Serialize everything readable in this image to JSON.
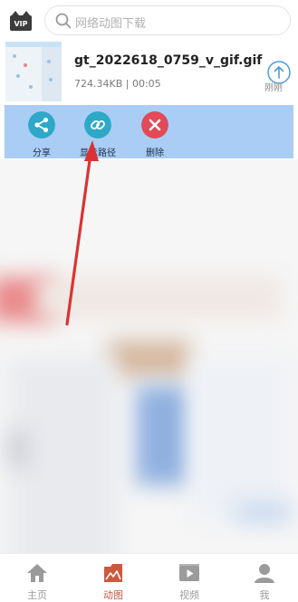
{
  "header": {
    "search_placeholder": "网络动图下载",
    "vip_label": "VIP"
  },
  "file": {
    "name": "gt_2022618_0759_v_gif.gif",
    "size": "724.34KB",
    "duration": "00:05",
    "meta_text": "724.34KB | 00:05",
    "time_label": "刚刚"
  },
  "actions": {
    "share": "分享",
    "show_path": "显示路径",
    "delete": "删除"
  },
  "nav": {
    "home": "主页",
    "gif": "动图",
    "video": "视频",
    "me": "我",
    "active": "动图"
  },
  "colors": {
    "action_bar_bg": "#a9cdf5",
    "icon_teal": "#2ea8c7",
    "icon_red": "#e14a56",
    "arrow_red": "#d93433",
    "nav_active": "#c95a3e"
  }
}
